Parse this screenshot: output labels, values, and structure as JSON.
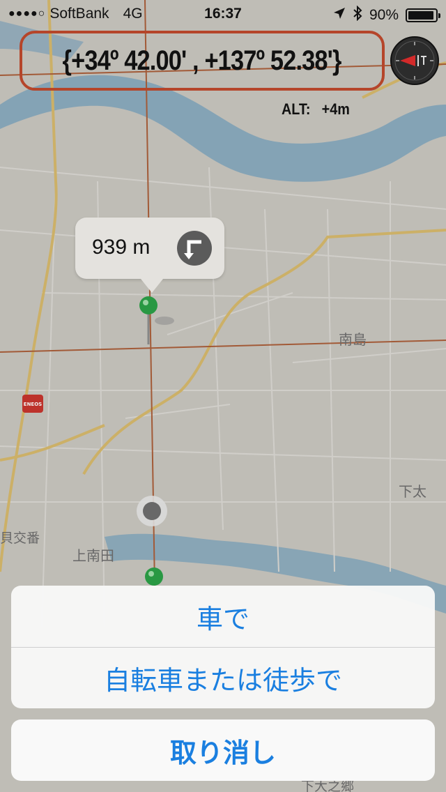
{
  "status_bar": {
    "signal": "●●●●○",
    "carrier": "SoftBank",
    "network": "4G",
    "time": "16:37",
    "battery_text": "90%",
    "battery_level": 0.9
  },
  "overlay": {
    "coordinates": "{+34º 42.00' , +137º 52.38'}",
    "altitude_label": "ALT:",
    "altitude_value": "+4m"
  },
  "map": {
    "place_labels": [
      "南島",
      "下太",
      "貝交番",
      "上南田",
      "下大之郷"
    ],
    "poi_brand": "ENEOS",
    "callout_distance": "939 m"
  },
  "action_sheet": {
    "options": [
      "車で",
      "自転車または徒歩で"
    ],
    "cancel": "取り消し"
  },
  "colors": {
    "accent": "#1a7fe0",
    "frame": "#b5452a",
    "water": "#6f9fbd",
    "road": "#d8b865",
    "route_line": "#a8562e",
    "pin": "#1e9c3c",
    "map_bg": "#c9c6bf"
  },
  "icons": [
    "location-arrow-icon",
    "bluetooth-icon",
    "battery-icon",
    "compass-icon",
    "turn-icon",
    "pin-icon",
    "gas-station-icon"
  ]
}
